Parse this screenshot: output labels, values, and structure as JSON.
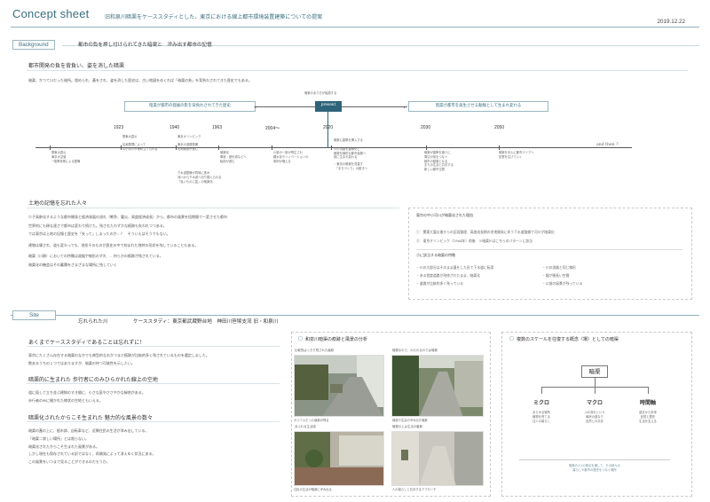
{
  "header": {
    "title": "Concept sheet",
    "subtitle": "旧和泉川暗渠をケーススタディとした、東京における線上都市環境装置建築についての提案",
    "date": "2019.12.22"
  },
  "background": {
    "label": "Background",
    "tagline": "都市の負を押し付けられてきた暗渠と　滲み出す都市の記憶",
    "heading1": "都市開発の負を背負い、姿を消した暗渠",
    "intro": "暗渠、かつて川だった暗所。埋められ、蓋をされ、姿を消した歴史は、古い地図をめくれば「暗渠の負」を背負わされてきた歴史でもある。",
    "timeline": {
      "present_caption": "暗渠のあり方が転換する",
      "present_label": "present",
      "past_box": "暗渠が都市の発展の影を背負わされてきた歴史",
      "future_box": "暗渠が都市を再生させる動脈として生まれ変わる",
      "and_then": "and then ?",
      "years": [
        "1923",
        "1940",
        "1963",
        "2004〜",
        "2020",
        "2030",
        "2050"
      ],
      "events": [
        {
          "title": "",
          "lines": [
            "関東大震災",
            "東京大空襲",
            "→復興事業による整備"
          ]
        },
        {
          "title": "関東大震災",
          "lines": [
            "区画整理によって",
            "中小河川が埋め立てられる"
          ]
        },
        {
          "title": "東京オリンピック",
          "lines": [
            "東京の道路整備",
            "宅地開発が進む",
            "下水道整備が同時に進み",
            "河川から下水道へ切り替えられる",
            "「臭いものに蓋」の暗渠化"
          ]
        },
        {
          "title": "暗渠化",
          "lines": [
            "車道・遊歩道などへ",
            "転用が進む"
          ]
        },
        {
          "title": "",
          "lines": [
            "川跡の一部が再生され",
            "親水化やリノベーションの",
            "事例が増える"
          ]
        },
        {
          "title": "暗渠に建築を挿入する",
          "lines": [
            "川の流路を建築化し",
            "暗渠を線的な都市装置へ",
            "街に生まれ変わる",
            "・東京の暗渠を見直す",
            "　「まちづくり」の動きへ"
          ]
        },
        {
          "title": "",
          "lines": [
            "暗渠が建築を媒介に",
            "周辺の街をつなぐ",
            "都市の動脈となる",
            "まちの生活と共存する",
            "新しい都市空間"
          ]
        },
        {
          "title": "",
          "lines": [
            "暗渠を中心に都市エリアへ",
            "影響を広げていく"
          ]
        }
      ]
    },
    "heading2": "土地の記憶を忘れた人々",
    "para2": [
      "少子高齢化するような都市開発と経済発展の流れ（戦争、震災、高度経済成長）から、都市の風景を短期間で一変させた都市",
      "世界的にも稀な速さで都市は変わり続けた。残されたわずかな痕跡も失われつつある。",
      "では東京は土地の記憶と歴史を「失って」しまったのか…？　そういえばそうでもない。",
      "建物は壊され、道も変わっても、地形そのものが歴史の中で刻まれた独特の形状を残していることもある。",
      "暗渠（川跡）においての特徴は道幅や線形のずれ　…何らかの痕跡が残されている。",
      "暗渠化の機会はその蓄積をさまざまな場所に残していく"
    ],
    "side_box": {
      "title": "東京の中小河川が暗渠化された理由",
      "items": [
        "①　関東大震災後からの区画整理、高度成長期の宅地開発に伴う下水道整備で河川が暗渠化",
        "②　東京オリンピック（1964年）前後　※暗渠川はこちらのパターンに該当"
      ],
      "title2": "②に該当する暗渠の特徴",
      "points": [
        "・川の大部分はそのまま蓋をした形で下水道に転用",
        "・ある程度道路が改修されたまま、暗渠化",
        "・道路が比較的多く残っている",
        "・川の流路と同じ線形",
        "・幅が細長い空間",
        "・以前の風景が残っている"
      ]
    }
  },
  "site": {
    "label": "Site",
    "river": "忘れられた川",
    "case": "ケーススタディ：東京都武蔵野台地　神田川笹塚支流 旧・和泉川",
    "left": {
      "h1": "あくまでケーススタディであることは忘れずに！",
      "p1": [
        "東京にたくさん存在する暗渠のなかでも典型的なおかつまだ痕跡が比較的多く残されているものを選定しました。",
        "数あるうちの１つではありますが、暗渠の持つ可能性を示したい。"
      ],
      "h2": "暗渠的に生まれた 歩行者にのみひらかれた線上の空地",
      "p2": [
        "道に面して立ち並ぶ建物のすき間に、小さな庭やささやかな緑地がある。",
        "歩行者のみに開かれた線状の空地ともいえる。"
      ],
      "h3": "暗渠化されたからこそ生まれた 魅力的な風景の数々",
      "p3": [
        "暗渠の蓋の上に、植木鉢、自転車など、近隣住民の生活が滲み出している。",
        "「暗渠＝寂しい場所」とは限らない。",
        "暗渠化されたからこそ生まれた風景がある。",
        "しかし現在も保存されている訳ではなく、再開発によって消えゆく状況にある。",
        "この風景をいつまで見ることができるのだろうか。"
      ]
    },
    "middle": {
      "title": "和泉川暗渠の痕跡と風景の分析",
      "photos": [
        {
          "caption": "比較的はっきり残された痕跡"
        },
        {
          "caption": "暗渠なので、わたれるのでは暗渠"
        },
        {
          "caption": "あふれる生活感"
        },
        {
          "caption": "暗渠の上は生活の裏側"
        }
      ],
      "photo_notes": [
        "かつて川だった痕跡が残る",
        "緑道や生活の滲み出す暗渠",
        "住民の生活が暗渠に滲み出る",
        "人の暮らしと共存するアプローチ"
      ]
    },
    "right": {
      "title": "複数のスケールを往復する概念（場）としての暗渠",
      "root": "暗渠",
      "nodes": [
        {
          "label": "ミクロ",
          "desc": [
            "あらゆる場所",
            "植物を育てる",
            "住人の暮らし"
          ]
        },
        {
          "label": "マクロ",
          "desc": [
            "川の流れという",
            "線状の連なり",
            "自然との共存"
          ]
        },
        {
          "label": "時間軸",
          "desc": [
            "過去から未来",
            "記憶と歴史",
            "生活を支える"
          ]
        }
      ],
      "footer": [
        "暗渠の3つの視点を通して、その時々の",
        "暮らしや都市の歴史をつなぐ場所"
      ]
    }
  }
}
